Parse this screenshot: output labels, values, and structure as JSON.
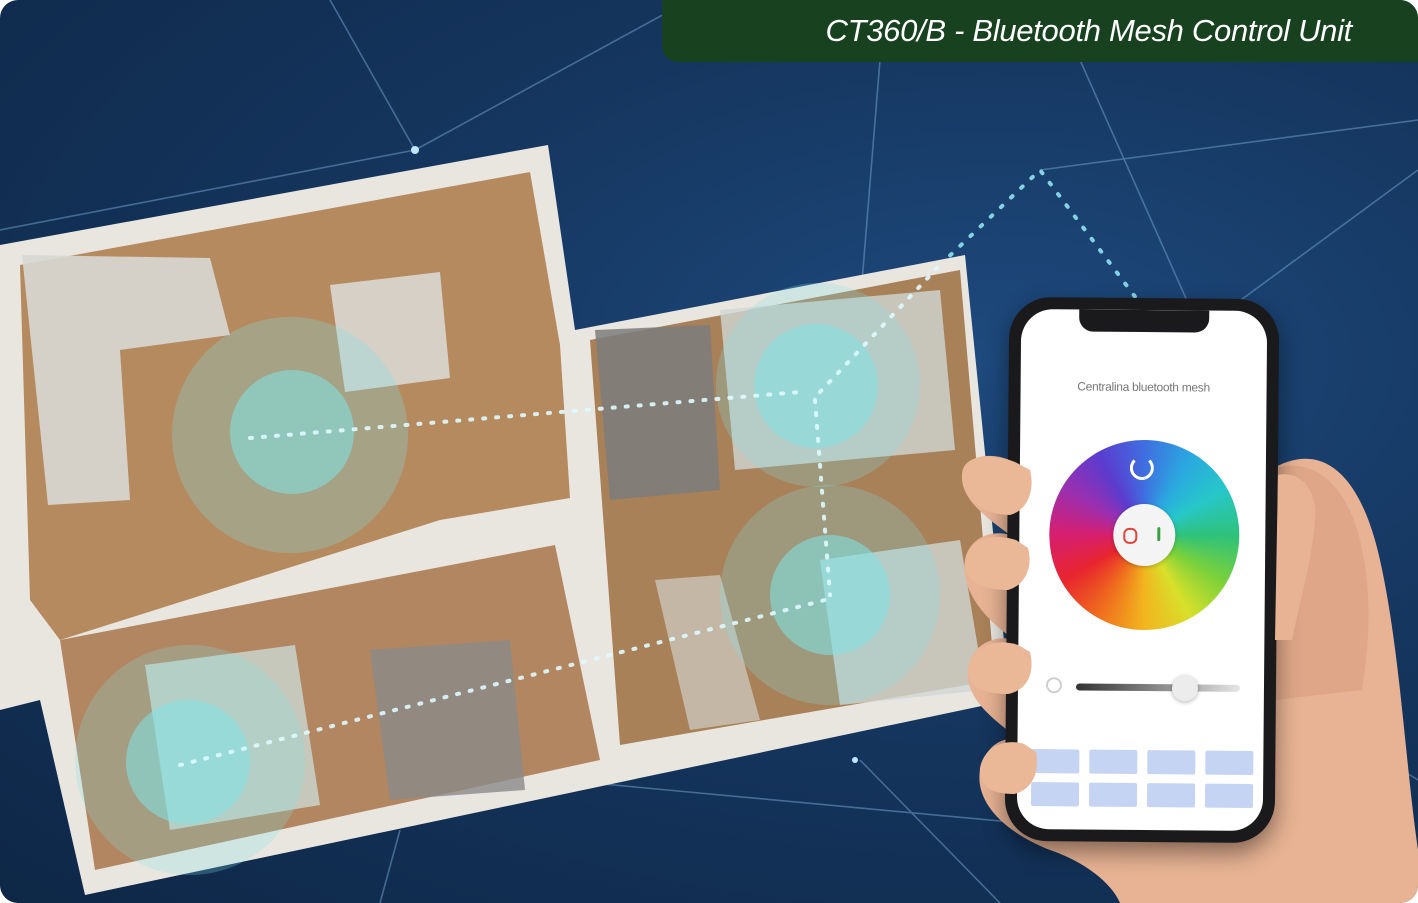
{
  "banner": {
    "title": "CT360/B - Bluetooth Mesh Control Unit",
    "background": "#18421f"
  },
  "scene": {
    "background_color": "#15365f",
    "mesh_dot_color": "#8fe3f0",
    "coverage_color": "#7fe3e8"
  },
  "phone": {
    "app_title": "Centralina bluetooth mesh",
    "icons": [
      "refresh-icon",
      "power-off-icon",
      "power-on-icon",
      "bulb-icon"
    ],
    "brightness_level": 0.72,
    "preset_count": 8,
    "preset_color": "#c5d4f2"
  }
}
